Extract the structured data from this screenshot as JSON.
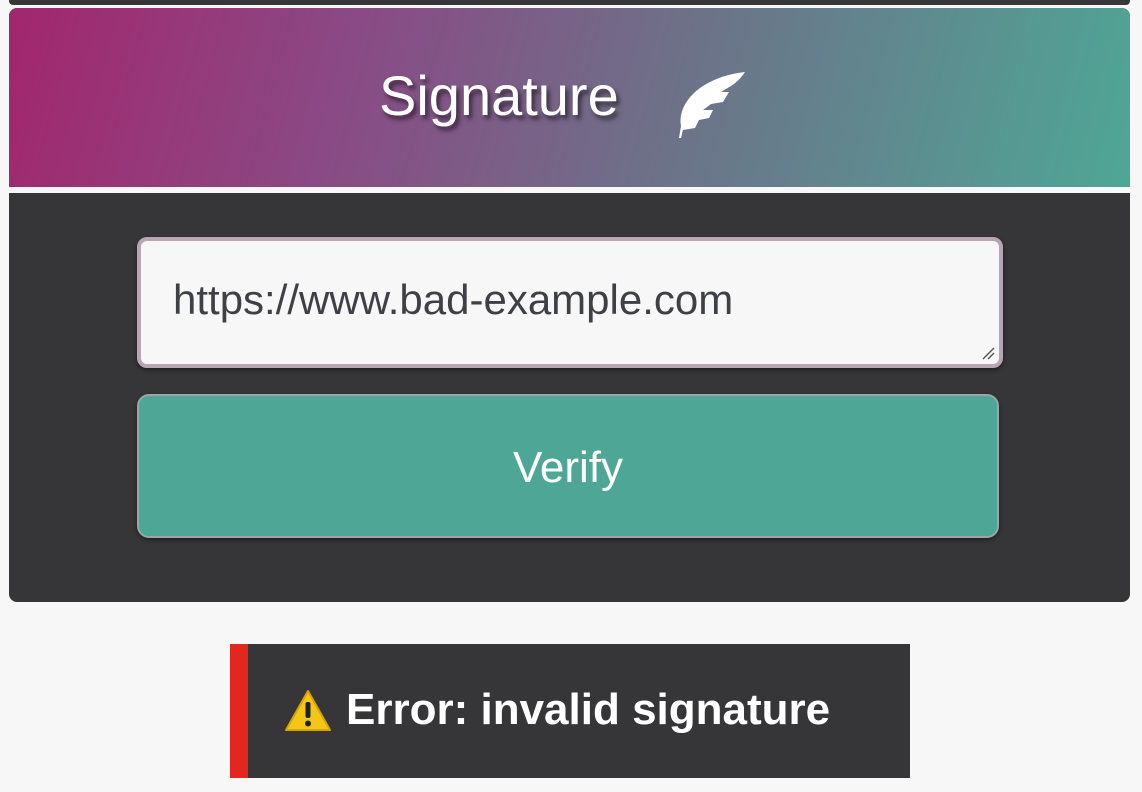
{
  "header": {
    "title": "Signature",
    "icon": "quill-icon"
  },
  "url_input": {
    "value": "https://www.bad-example.com"
  },
  "verify_button": {
    "label": "Verify"
  },
  "error": {
    "icon": "warning-icon",
    "message": "Error: invalid signature"
  },
  "colors": {
    "header_gradient_start": "#a2266d",
    "header_gradient_end": "#4ea796",
    "panel_background": "#363638",
    "button_background": "#4ea796",
    "error_accent": "#e3271f",
    "warning_yellow": "#f5c518"
  }
}
